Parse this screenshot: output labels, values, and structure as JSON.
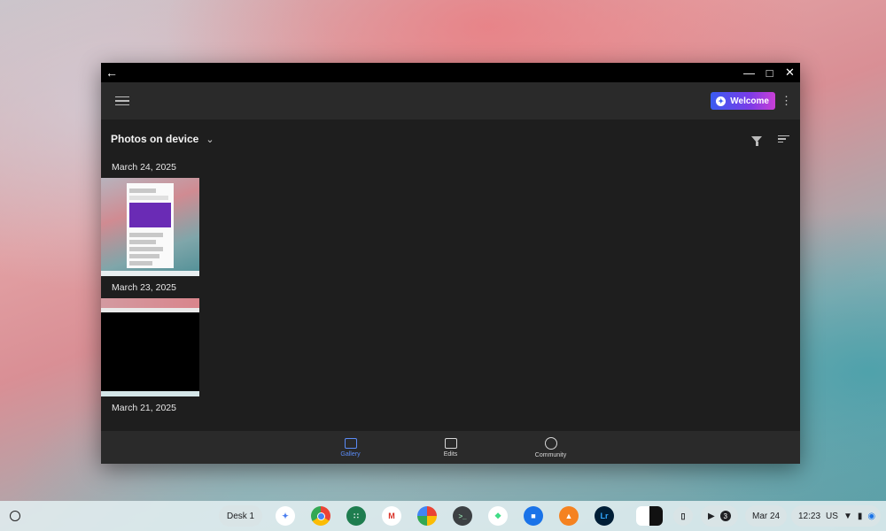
{
  "window": {
    "back_icon": "arrow-left-icon",
    "controls": [
      "minimize-icon",
      "maximize-icon",
      "close-icon"
    ]
  },
  "appbar": {
    "menu_icon": "hamburger-menu-icon",
    "welcome_label": "Welcome",
    "more_icon": "more-vertical-icon"
  },
  "toolbar": {
    "source_label": "Photos on device",
    "source_dropdown_icon": "chevron-down-icon",
    "filter_icon": "filter-icon",
    "sort_icon": "sort-icon"
  },
  "gallery": {
    "groups": [
      {
        "date": "March 24, 2025"
      },
      {
        "date": "March 23, 2025"
      },
      {
        "date": "March 21, 2025"
      }
    ]
  },
  "bottom_nav": {
    "items": [
      {
        "label": "Gallery",
        "icon": "gallery-icon",
        "active": true
      },
      {
        "label": "Edits",
        "icon": "edits-icon",
        "active": false
      },
      {
        "label": "Community",
        "icon": "globe-icon",
        "active": false
      }
    ]
  },
  "shelf": {
    "desk_label": "Desk 1",
    "apps": [
      "gemini-icon",
      "chrome-icon",
      "google-apps-icon",
      "gmail-icon",
      "photos-icon",
      "terminal-icon",
      "android-studio-icon",
      "files-icon",
      "vlc-icon",
      "lightroom-icon",
      "screenshot-app-icon",
      "phone-hub-icon"
    ],
    "lightroom_label": "Lr",
    "notification_count": "3",
    "date": "Mar 24",
    "time": "12:23",
    "keyboard_layout": "US",
    "accent_color": "#5b8cf7"
  }
}
